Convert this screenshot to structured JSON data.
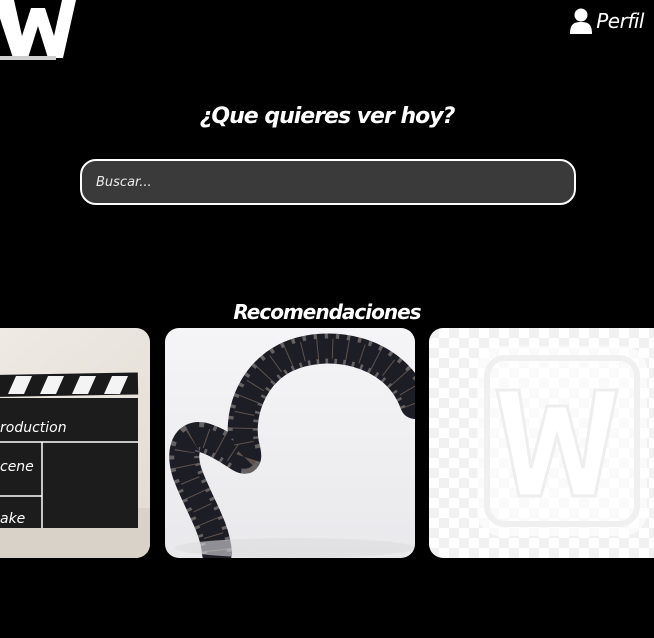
{
  "header": {
    "logo_letter": "W",
    "profile_label": "Perfil",
    "profile_icon": "user-icon"
  },
  "hero": {
    "title": "¿Que quieres ver hoy?"
  },
  "search": {
    "placeholder": "Buscar..."
  },
  "recommendations": {
    "title": "Recomendaciones",
    "cards": [
      {
        "image": "clapperboard-image",
        "board_lines": [
          "roduction",
          "cene",
          "ake"
        ]
      },
      {
        "image": "film-reel-image"
      },
      {
        "image": "w-logo-placeholder-image",
        "letter": "W"
      }
    ]
  },
  "colors": {
    "background": "#000000",
    "text": "#ffffff",
    "search_bg": "#3a3a3a",
    "search_border": "#ffffff"
  }
}
